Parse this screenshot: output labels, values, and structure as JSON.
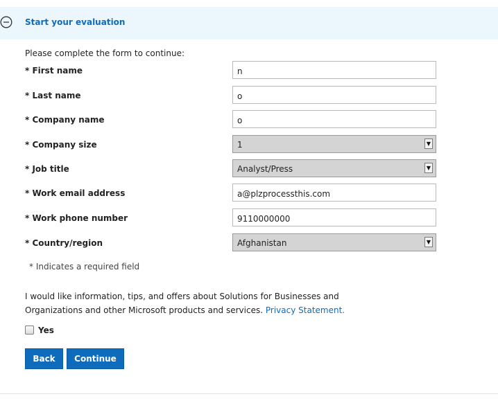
{
  "panel": {
    "title": "Start your evaluation",
    "collapse_icon": "minus-circle-icon",
    "header_bg": "#ecf7fd",
    "accent": "#0f6cbd"
  },
  "form": {
    "intro": "Please complete the form to continue:",
    "fields": [
      {
        "label": "* First name",
        "type": "text",
        "value": "n"
      },
      {
        "label": "* Last name",
        "type": "text",
        "value": "o"
      },
      {
        "label": "* Company name",
        "type": "text",
        "value": "o"
      },
      {
        "label": "* Company size",
        "type": "select",
        "value": "1"
      },
      {
        "label": "* Job title",
        "type": "select",
        "value": "Analyst/Press"
      },
      {
        "label": "* Work email address",
        "type": "text",
        "value": "a@plzprocessthis.com"
      },
      {
        "label": "* Work phone number",
        "type": "text",
        "value": "9110000000"
      },
      {
        "label": "* Country/region",
        "type": "select",
        "value": "Afghanistan"
      }
    ],
    "required_note": "* Indicates a required field",
    "consent_text": "I would like information, tips, and offers about Solutions for Businesses and Organizations and other Microsoft products and services.",
    "privacy_link": "Privacy Statement.",
    "checkbox_label": "Yes",
    "checkbox_checked": false
  },
  "buttons": {
    "back": "Back",
    "continue": "Continue"
  }
}
